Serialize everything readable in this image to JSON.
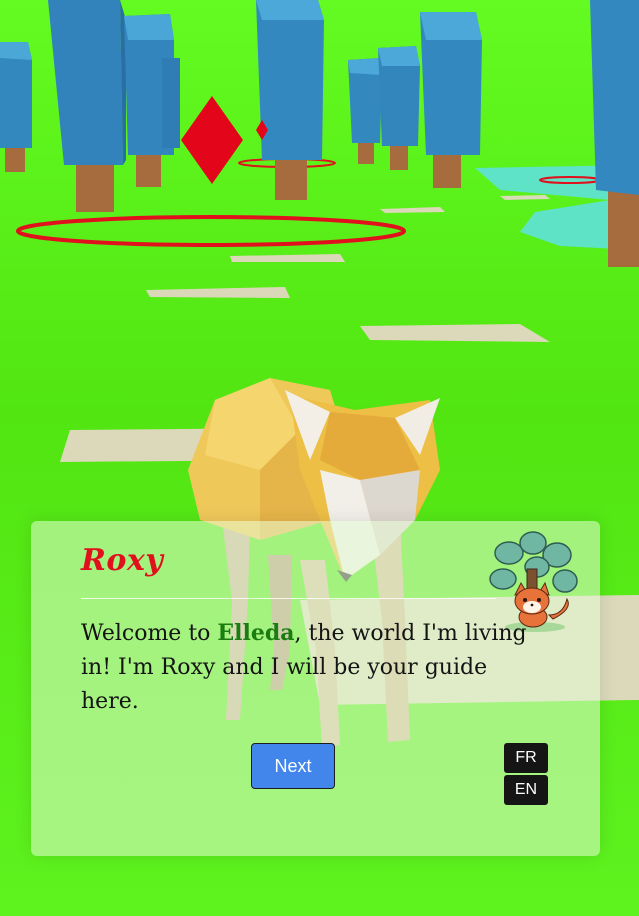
{
  "dialog": {
    "speaker": "Roxy",
    "message_before": "Welcome to ",
    "world_name": "Elleda",
    "message_after": ", the world I'm living in! I'm Roxy and I will be your guide here.",
    "next_label": "Next",
    "lang_fr": "FR",
    "lang_en": "EN",
    "avatar_icon": "fox-under-tree-icon"
  },
  "colors": {
    "grass": "#5ef21f",
    "speaker_name": "#e0101c",
    "world_name": "#1a7d12",
    "next_button": "#4286ec",
    "lang_button": "#151515",
    "marker": "#e0101c"
  }
}
